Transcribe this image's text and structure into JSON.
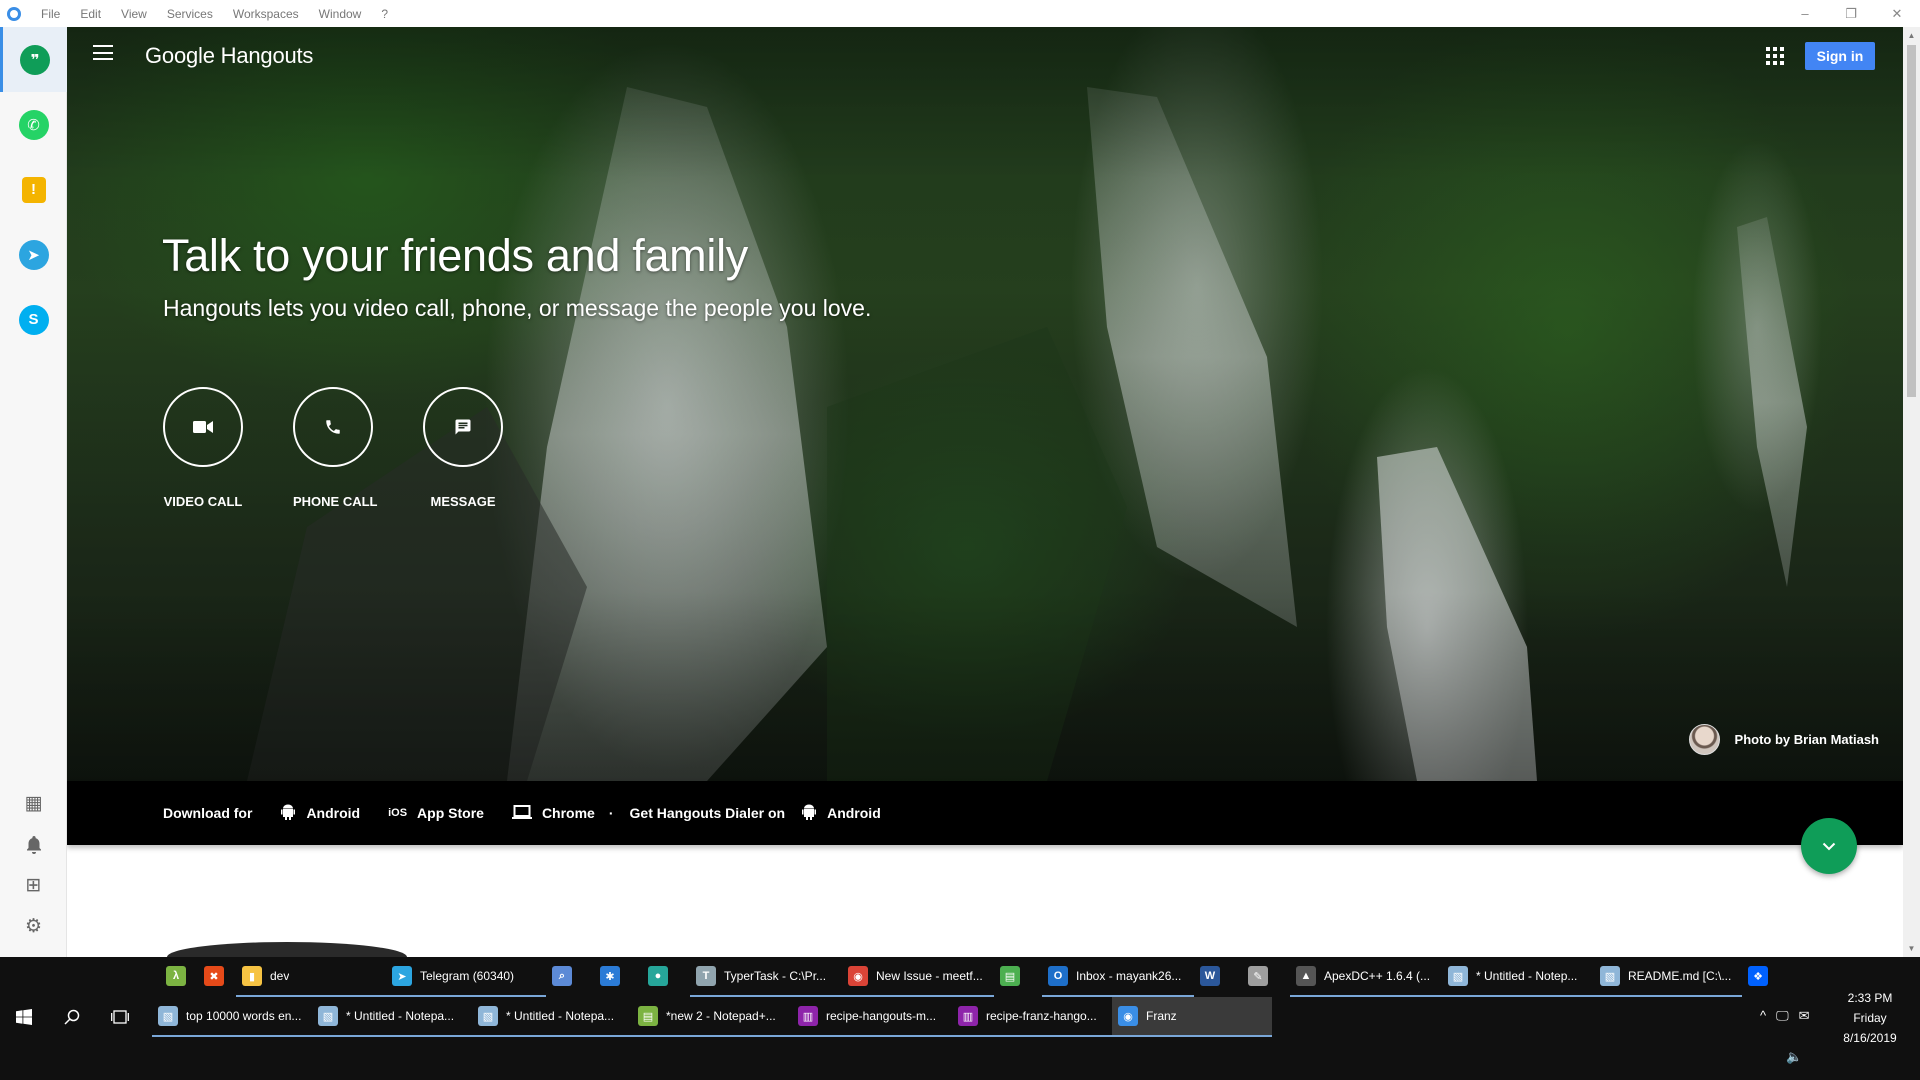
{
  "menubar": {
    "items": [
      "File",
      "Edit",
      "View",
      "Services",
      "Workspaces",
      "Window",
      "?"
    ],
    "controls": {
      "minimize": "–",
      "restore": "❐",
      "close": "✕"
    }
  },
  "sidebar": {
    "services": [
      {
        "name": "hangouts",
        "icon": "hangouts-icon",
        "color": "#0f9d58",
        "glyph": "❞"
      },
      {
        "name": "whatsapp",
        "icon": "whatsapp-icon",
        "color": "#25d366",
        "glyph": "✆"
      },
      {
        "name": "keep",
        "icon": "keep-icon",
        "color": "#f4b400",
        "glyph": "💡"
      },
      {
        "name": "telegram",
        "icon": "telegram-icon",
        "color": "#2ca5e0",
        "glyph": "➤"
      },
      {
        "name": "skype",
        "icon": "skype-icon",
        "color": "#00aff0",
        "glyph": "S"
      }
    ],
    "tools": [
      {
        "icon": "workspaces-icon",
        "glyph": "▦"
      },
      {
        "icon": "notifications-icon",
        "glyph": "🔔"
      },
      {
        "icon": "add-service-icon",
        "glyph": "⊞"
      },
      {
        "icon": "settings-icon",
        "glyph": "⚙"
      }
    ]
  },
  "hangouts": {
    "logo": "Google Hangouts",
    "sign_in": "Sign in",
    "headline": "Talk to your friends and family",
    "subline": "Hangouts lets you video call, phone, or message the people you love.",
    "actions": [
      {
        "label": "VIDEO CALL",
        "icon": "video-camera-icon"
      },
      {
        "label": "PHONE CALL",
        "icon": "phone-icon"
      },
      {
        "label": "MESSAGE",
        "icon": "message-icon"
      }
    ],
    "photo_credit": "Photo by Brian Matiash",
    "download": {
      "prefix": "Download for",
      "android": "Android",
      "ios_glyph": "iOS",
      "app_store": "App Store",
      "chrome": "Chrome",
      "separator": "·",
      "dialer": "Get Hangouts Dialer on",
      "dialer_android": "Android"
    }
  },
  "taskbar": {
    "top_row": [
      {
        "label": "",
        "icon": "lambda-icon",
        "color": "#7cb342",
        "glyph": "λ",
        "state": ""
      },
      {
        "label": "",
        "icon": "x-tool-icon",
        "color": "#e64a19",
        "glyph": "✖",
        "state": ""
      },
      {
        "label": "dev",
        "icon": "folder-icon",
        "color": "#f6c343",
        "glyph": "▮",
        "state": "open"
      },
      {
        "label": "Telegram (60340)",
        "icon": "telegram-icon",
        "color": "#2ca5e0",
        "glyph": "➤",
        "state": "open"
      },
      {
        "label": "",
        "icon": "search-tool-icon",
        "color": "#5c8ad6",
        "glyph": "⌕",
        "state": ""
      },
      {
        "label": "",
        "icon": "network-icon",
        "color": "#2b7bd6",
        "glyph": "✱",
        "state": ""
      },
      {
        "label": "",
        "icon": "circle-app-icon",
        "color": "#26a69a",
        "glyph": "●",
        "state": ""
      },
      {
        "label": "TyperTask - C:\\Pr...",
        "icon": "typertask-icon",
        "color": "#90a4ae",
        "glyph": "T",
        "state": "open"
      },
      {
        "label": "New Issue - meetf...",
        "icon": "chrome-icon",
        "color": "#db4437",
        "glyph": "◉",
        "state": "open"
      },
      {
        "label": "",
        "icon": "excel-like-icon",
        "color": "#4caf50",
        "glyph": "▤",
        "state": ""
      },
      {
        "label": "Inbox - mayank26...",
        "icon": "outlook-icon",
        "color": "#1e6fc9",
        "glyph": "O",
        "state": "open"
      },
      {
        "label": "",
        "icon": "word-icon",
        "color": "#2b579a",
        "glyph": "W",
        "state": ""
      },
      {
        "label": "",
        "icon": "pen-icon",
        "color": "#9e9e9e",
        "glyph": "✎",
        "state": ""
      },
      {
        "label": "ApexDC++ 1.6.4 (...",
        "icon": "apexdc-icon",
        "color": "#555555",
        "glyph": "▲",
        "state": "open"
      },
      {
        "label": "* Untitled - Notep...",
        "icon": "notepad-icon",
        "color": "#8fb6d8",
        "glyph": "▧",
        "state": "open"
      },
      {
        "label": "README.md [C:\\...",
        "icon": "notepad-icon",
        "color": "#8fb6d8",
        "glyph": "▧",
        "state": "open"
      },
      {
        "label": "",
        "icon": "dropbox-icon",
        "color": "#0061fe",
        "glyph": "❖",
        "state": ""
      }
    ],
    "bottom_row": [
      {
        "label": "top 10000 words en...",
        "icon": "notepad-icon",
        "color": "#8fb6d8",
        "glyph": "▧",
        "state": "open"
      },
      {
        "label": "* Untitled - Notepa...",
        "icon": "notepad-icon",
        "color": "#8fb6d8",
        "glyph": "▧",
        "state": "open"
      },
      {
        "label": "* Untitled - Notepa...",
        "icon": "notepad-icon",
        "color": "#8fb6d8",
        "glyph": "▧",
        "state": "open"
      },
      {
        "label": "*new 2 - Notepad+...",
        "icon": "notepadpp-icon",
        "color": "#7cb342",
        "glyph": "▤",
        "state": "open"
      },
      {
        "label": "recipe-hangouts-m...",
        "icon": "winrar-icon",
        "color": "#8e24aa",
        "glyph": "▥",
        "state": "open"
      },
      {
        "label": "recipe-franz-hango...",
        "icon": "winrar-icon",
        "color": "#8e24aa",
        "glyph": "▥",
        "state": "open"
      },
      {
        "label": "Franz",
        "icon": "franz-icon",
        "color": "#3a8ee6",
        "glyph": "◉",
        "state": "active"
      }
    ],
    "clock": {
      "time": "2:33 PM",
      "day": "Friday",
      "date": "8/16/2019"
    }
  }
}
